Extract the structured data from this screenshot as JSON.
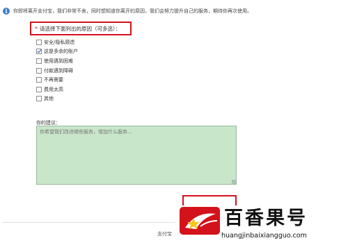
{
  "notice": {
    "icon": "info-icon",
    "text": "你即将离开支付宝，我们非常不舍，同时想知道你离开的原因，我们会努力提升自己的服务，期待你再次使用。"
  },
  "reasons": {
    "required_mark": "*",
    "title": "请选择下面列出的原因（可多选）：",
    "options": [
      {
        "label": "安全/隐私顾虑",
        "checked": false
      },
      {
        "label": "这是多余的账户",
        "checked": true
      },
      {
        "label": "使用遇到困难",
        "checked": false
      },
      {
        "label": "付款遇到障碍",
        "checked": false
      },
      {
        "label": "不再需要",
        "checked": false
      },
      {
        "label": "费用太高",
        "checked": false
      },
      {
        "label": "其他",
        "checked": false
      }
    ]
  },
  "suggestion": {
    "label": "你的建议：",
    "placeholder": "你希望我们改进哪些服务，增加什么服务..."
  },
  "footer": {
    "text": "支付宝"
  },
  "watermark": {
    "title": "百香果号",
    "url": "huangjinbaixiangguo.com",
    "accent_color": "#d4121b"
  },
  "colors": {
    "highlight_red": "#d4121b",
    "textarea_green": "#c8e6c9"
  }
}
